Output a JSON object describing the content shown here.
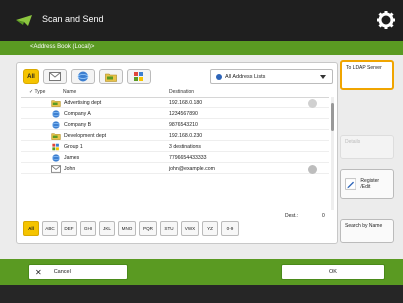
{
  "app": {
    "title": "Scan and Send"
  },
  "subbar": {
    "label": "<Address Book (Local)>"
  },
  "tabs": [
    {
      "label": "All",
      "icon": "all-tab"
    },
    {
      "label": "",
      "icon": "email-icon"
    },
    {
      "label": "",
      "icon": "globe-icon"
    },
    {
      "label": "",
      "icon": "folder-icon"
    },
    {
      "label": "",
      "icon": "group-icon"
    }
  ],
  "address_list": {
    "selected": "All Address Lists"
  },
  "columns": {
    "type": "Type",
    "name": "Name",
    "destination": "Destination"
  },
  "rows": [
    {
      "name": "Advertising dept",
      "destination": "192.168.0.180",
      "icon": "folder-icon"
    },
    {
      "name": "Company A",
      "destination": "1234567890",
      "icon": "globe-icon"
    },
    {
      "name": "Company B",
      "destination": "9876543210",
      "icon": "globe-icon"
    },
    {
      "name": "Development dept",
      "destination": "192.168.0.230",
      "icon": "folder-icon"
    },
    {
      "name": "Group 1",
      "destination": "3 destinations",
      "icon": "group-icon"
    },
    {
      "name": "James",
      "destination": "7796654433333",
      "icon": "globe-icon"
    },
    {
      "name": "John",
      "destination": "john@example.com",
      "icon": "email-icon"
    }
  ],
  "dest_count": {
    "label": "Dest.:",
    "value": "0"
  },
  "kana_keys": [
    "All",
    "ABC",
    "DEF",
    "GHI",
    "JKL",
    "MNO",
    "PQR",
    "STU",
    "VWX",
    "YZ",
    "0-9"
  ],
  "side_buttons": {
    "ldap": "To LDAP Server",
    "details": "Details",
    "register": "Register /Edit",
    "search": "Search by Name"
  },
  "footer": {
    "cancel": "Cancel",
    "ok": "OK"
  },
  "colors": {
    "accent_green": "#5a9a22",
    "highlight_yellow": "#f5c400",
    "ldap_border": "#f0a500"
  }
}
